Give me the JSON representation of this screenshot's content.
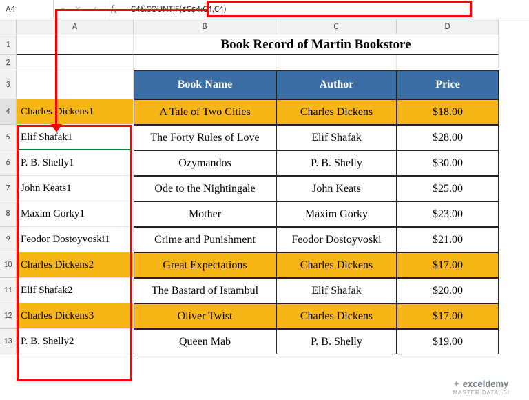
{
  "name_box": "A4",
  "formula": "=C4&COUNTIF($C$4:C4,C4)",
  "columns": [
    "A",
    "B",
    "C",
    "D"
  ],
  "col_widths": {
    "A": 170,
    "B": 207,
    "C": 175,
    "D": 148
  },
  "title": "Book Record of Martin Bookstore",
  "headers": {
    "B": "Book Name",
    "C": "Author",
    "D": "Price"
  },
  "rows": [
    {
      "n": 4,
      "a": "Charles Dickens1",
      "b": "A Tale of Two Cities",
      "c": "Charles Dickens",
      "d": "$18.00",
      "hl": true
    },
    {
      "n": 5,
      "a": "Elif Shafak1",
      "b": "The Forty Rules of Love",
      "c": "Elif Shafak",
      "d": "$28.00",
      "hl": false
    },
    {
      "n": 6,
      "a": "P. B. Shelly1",
      "b": "Ozymandos",
      "c": "P. B. Shelly",
      "d": "$30.00",
      "hl": false
    },
    {
      "n": 7,
      "a": "John Keats1",
      "b": "Ode to the Nightingale",
      "c": "John Keats",
      "d": "$25.00",
      "hl": false
    },
    {
      "n": 8,
      "a": "Maxim Gorky1",
      "b": "Mother",
      "c": "Maxim Gorky",
      "d": "$23.00",
      "hl": false
    },
    {
      "n": 9,
      "a": "Feodor Dostoyvoski1",
      "b": "Crime and Punishment",
      "c": "Feodor Dostoyvoski",
      "d": "$21.00",
      "hl": false
    },
    {
      "n": 10,
      "a": "Charles Dickens2",
      "b": "Great Expectations",
      "c": "Charles Dickens",
      "d": "$17.00",
      "hl": true
    },
    {
      "n": 11,
      "a": "Elif Shafak2",
      "b": "The Bastard of Istambul",
      "c": "Elif Shafak",
      "d": "$20.00",
      "hl": false
    },
    {
      "n": 12,
      "a": "Charles Dickens3",
      "b": "Oliver Twist",
      "c": "Charles Dickens",
      "d": "$17.00",
      "hl": true
    },
    {
      "n": 13,
      "a": "P. B. Shelly2",
      "b": "Queen Mab",
      "c": "P. B. Shelly",
      "d": "$19.00",
      "hl": false
    }
  ],
  "row_heights": {
    "1": 30,
    "2": 22,
    "3": 42,
    "data": 37
  },
  "watermark": {
    "brand": "exceldemy",
    "tag": "MASTER DATA. BI"
  }
}
